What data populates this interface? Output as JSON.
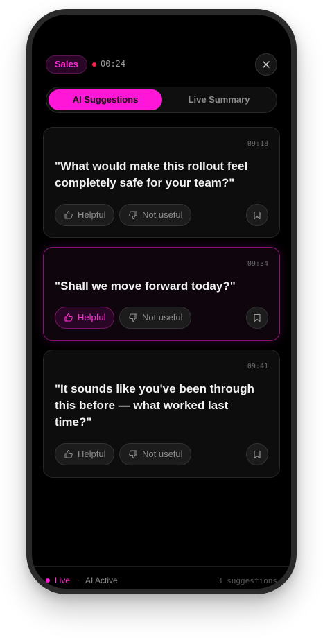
{
  "header": {
    "category_tag": "Sales",
    "timer": "00:24"
  },
  "tabs": [
    {
      "label": "AI Suggestions",
      "active": true
    },
    {
      "label": "Live Summary",
      "active": false
    }
  ],
  "suggestions": [
    {
      "time": "09:18",
      "text": "\"What would make this rollout feel completely safe for your team?\"",
      "helpful_label": "Helpful",
      "not_useful_label": "Not useful",
      "helpful_selected": false
    },
    {
      "time": "09:34",
      "text": "\"Shall we move forward today?\"",
      "helpful_label": "Helpful",
      "not_useful_label": "Not useful",
      "helpful_selected": true
    },
    {
      "time": "09:41",
      "text": "\"It sounds like you've been through this before — what worked last time?\"",
      "helpful_label": "Helpful",
      "not_useful_label": "Not useful",
      "helpful_selected": false
    }
  ],
  "footer": {
    "live_label": "Live",
    "separator": "·",
    "ai_status": "AI Active",
    "suggestion_count": "3 suggestions"
  },
  "colors": {
    "accent": "#ff16d6",
    "background": "#000000",
    "recording": "#ff1f4b"
  }
}
